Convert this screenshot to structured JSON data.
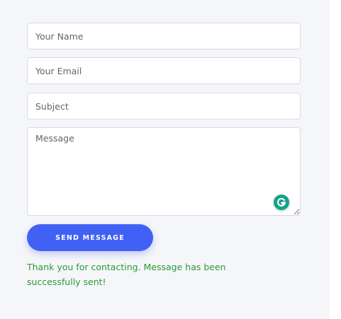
{
  "form": {
    "name_placeholder": "Your Name",
    "email_placeholder": "Your Email",
    "subject_placeholder": "Subject",
    "message_placeholder": "Message",
    "send_label": "SEND MESSAGE",
    "success_message": "Thank you for contacting. Message has been successfully sent!"
  },
  "icons": {
    "grammarly": "grammarly-icon"
  },
  "colors": {
    "button": "#4161f5",
    "success_text": "#2c9a33",
    "grammarly": "#14a287",
    "panel_background": "#f5f6fa"
  }
}
